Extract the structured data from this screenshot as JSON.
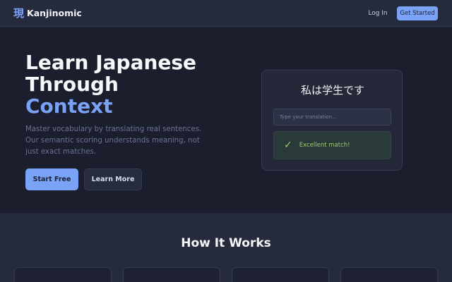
{
  "nav": {
    "logo_char": "現",
    "brand": "Kanjinomic",
    "login": "Log In",
    "cta": "Get Started"
  },
  "hero": {
    "title_line1": "Learn Japanese",
    "title_line2": "Through",
    "title_accent": "Context",
    "description": "Master vocabulary by translating real sentences. Our semantic scoring understands meaning, not just exact matches.",
    "primary_button": "Start Free",
    "secondary_button": "Learn More"
  },
  "demo": {
    "sentence": "私は学生です",
    "input_placeholder": "Type your translation...",
    "input_value": "",
    "feedback": "Excellent match!"
  },
  "how": {
    "title": "How It Works"
  },
  "colors": {
    "accent": "#7aa2f7",
    "success": "#9ece6a",
    "background": "#1b1e2d",
    "surface": "#252a3d"
  }
}
